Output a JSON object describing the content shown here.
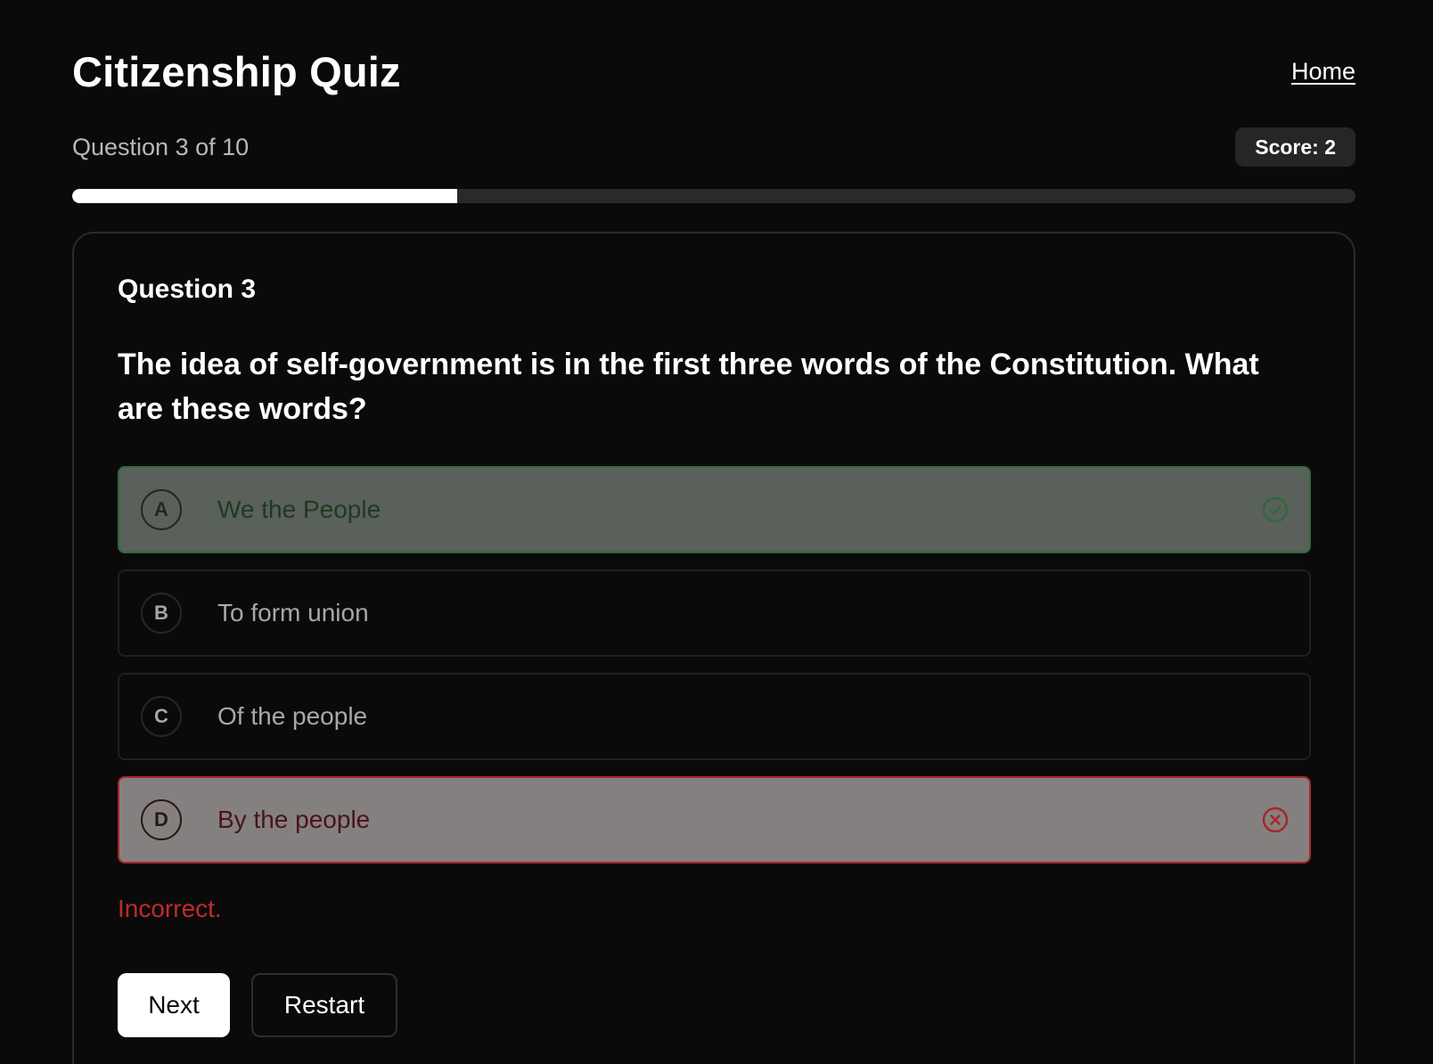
{
  "header": {
    "title": "Citizenship Quiz",
    "home_link": "Home"
  },
  "progress": {
    "label": "Question 3 of 10",
    "score": "Score: 2",
    "fraction": 0.3
  },
  "question": {
    "heading": "Question 3",
    "text": "The idea of self-government is in the first three words of the Constitution. What are these words?",
    "options": [
      {
        "letter": "A",
        "text": "We the People",
        "state": "correct",
        "icon": "check-circle-icon"
      },
      {
        "letter": "B",
        "text": "To form union",
        "state": "neutral",
        "icon": ""
      },
      {
        "letter": "C",
        "text": "Of the people",
        "state": "neutral",
        "icon": ""
      },
      {
        "letter": "D",
        "text": "By the people",
        "state": "incorrect",
        "icon": "x-circle-icon"
      }
    ],
    "feedback": "Incorrect."
  },
  "actions": {
    "next_label": "Next",
    "restart_label": "Restart"
  },
  "colors": {
    "background": "#0a0a0a",
    "correct_border": "#2f6a3a",
    "incorrect_border": "#a8262a",
    "feedback": "#c12a2a"
  }
}
